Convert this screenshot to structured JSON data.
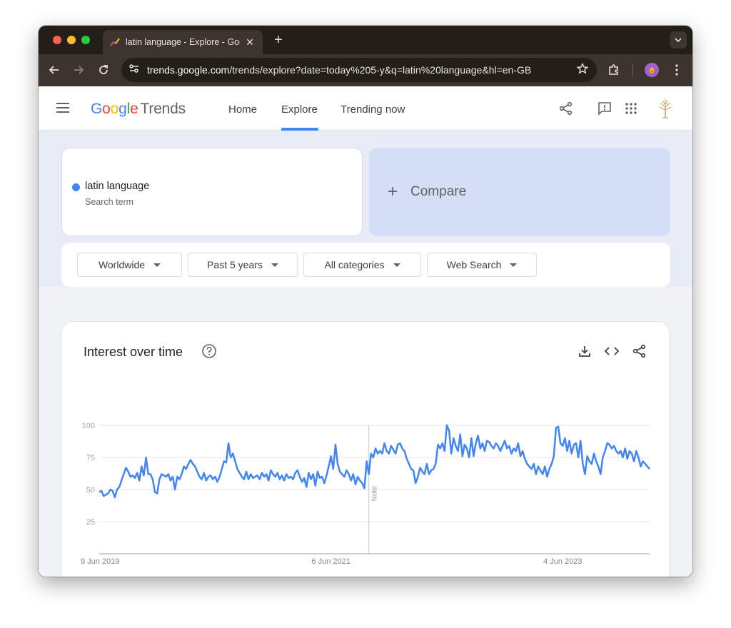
{
  "browser": {
    "tab_title": "latin language - Explore - Goo",
    "url_host": "trends.google.com",
    "url_path": "/trends/explore?date=today%205-y&q=latin%20language&hl=en-GB"
  },
  "header": {
    "logo_google": "Google",
    "logo_trends": "Trends",
    "nav": [
      "Home",
      "Explore",
      "Trending now"
    ],
    "active_nav": "Explore"
  },
  "search": {
    "term": "latin language",
    "term_sub": "Search term",
    "term_color": "#4285f4",
    "compare_label": "Compare"
  },
  "filters": [
    "Worldwide",
    "Past 5 years",
    "All categories",
    "Web Search"
  ],
  "card": {
    "title": "Interest over time"
  },
  "chart_data": {
    "type": "line",
    "series": [
      {
        "color": "#4285f4",
        "values": [
          48,
          49,
          45,
          46,
          47,
          50,
          49,
          44,
          50,
          52,
          57,
          62,
          67,
          64,
          60,
          61,
          59,
          63,
          57,
          68,
          61,
          75,
          62,
          62,
          58,
          48,
          47,
          58,
          62,
          61,
          60,
          62,
          57,
          60,
          50,
          60,
          58,
          62,
          68,
          66,
          70,
          73,
          70,
          68,
          64,
          60,
          58,
          63,
          57,
          60,
          61,
          58,
          60,
          56,
          60,
          66,
          72,
          71,
          86,
          75,
          78,
          72,
          66,
          63,
          60,
          58,
          64,
          58,
          62,
          59,
          60,
          61,
          58,
          63,
          60,
          62,
          57,
          65,
          62,
          60,
          63,
          58,
          61,
          57,
          62,
          59,
          60,
          58,
          63,
          65,
          60,
          56,
          59,
          52,
          63,
          58,
          62,
          53,
          64,
          59,
          60,
          55,
          61,
          68,
          76,
          66,
          85,
          70,
          64,
          62,
          60,
          65,
          62,
          57,
          62,
          54,
          60,
          57,
          55,
          51,
          72,
          62,
          78,
          75,
          82,
          78,
          80,
          78,
          86,
          80,
          78,
          84,
          81,
          78,
          85,
          86,
          82,
          80,
          74,
          70,
          66,
          65,
          55,
          60,
          67,
          64,
          62,
          70,
          62,
          65,
          66,
          70,
          85,
          82,
          86,
          80,
          100,
          96,
          78,
          90,
          84,
          80,
          93,
          76,
          85,
          82,
          75,
          90,
          76,
          86,
          92,
          82,
          86,
          80,
          88,
          87,
          84,
          82,
          86,
          84,
          80,
          84,
          88,
          82,
          84,
          78,
          82,
          80,
          86,
          76,
          80,
          74,
          70,
          68,
          66,
          70,
          62,
          68,
          65,
          62,
          68,
          60,
          66,
          70,
          76,
          98,
          99,
          86,
          84,
          90,
          80,
          88,
          78,
          85,
          86,
          75,
          88,
          70,
          62,
          76,
          72,
          70,
          78,
          72,
          68,
          62,
          75,
          80,
          86,
          85,
          82,
          84,
          80,
          78,
          80,
          75,
          82,
          74,
          80,
          78,
          72,
          80,
          75,
          68,
          72,
          70,
          68,
          66
        ],
        "annotation": "Note",
        "annotation_index": 121
      }
    ],
    "x_tick_labels": [
      "9 Jun 2019",
      "6 Jun 2021",
      "4 Jun 2023"
    ],
    "x_tick_index": [
      0,
      104,
      208
    ],
    "y_ticks": [
      25,
      50,
      75,
      100
    ],
    "ylim": [
      0,
      100
    ],
    "grid": true
  }
}
